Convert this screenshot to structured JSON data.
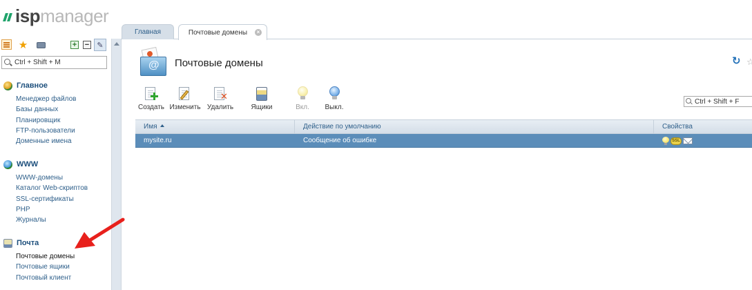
{
  "logo": {
    "part1": "isp",
    "part2": "manager"
  },
  "sidebar": {
    "search_placeholder": "Ctrl + Shift + M",
    "groups": [
      {
        "title": "Главное",
        "items": [
          "Менеджер файлов",
          "Базы данных",
          "Планировщик",
          "FTP-пользователи",
          "Доменные имена"
        ]
      },
      {
        "title": "WWW",
        "items": [
          "WWW-домены",
          "Каталог Web-скриптов",
          "SSL-сертификаты",
          "PHP",
          "Журналы"
        ]
      },
      {
        "title": "Почта",
        "items": [
          "Почтовые домены",
          "Почтовые ящики",
          "Почтовый клиент"
        ]
      }
    ]
  },
  "tabs": {
    "home": "Главная",
    "mail_domains": "Почтовые домены"
  },
  "page": {
    "title": "Почтовые домены"
  },
  "toolbar": {
    "create": "Создать",
    "edit": "Изменить",
    "delete": "Удалить",
    "mailboxes": "Ящики",
    "enable": "Вкл.",
    "disable": "Выкл."
  },
  "filter": {
    "placeholder": "Ctrl + Shift + F"
  },
  "table": {
    "columns": [
      "Имя",
      "Действие по умолчанию",
      "Свойства"
    ],
    "rows": [
      {
        "name": "mysite.ru",
        "default_action": "Сообщение об ошибке",
        "ssl_badge": "SSL"
      }
    ]
  },
  "colors": {
    "accent_blue": "#2e5f8a",
    "selected_row": "#5b8db9",
    "brand_green": "#1fa36b",
    "annotation_red": "#e8201c"
  }
}
